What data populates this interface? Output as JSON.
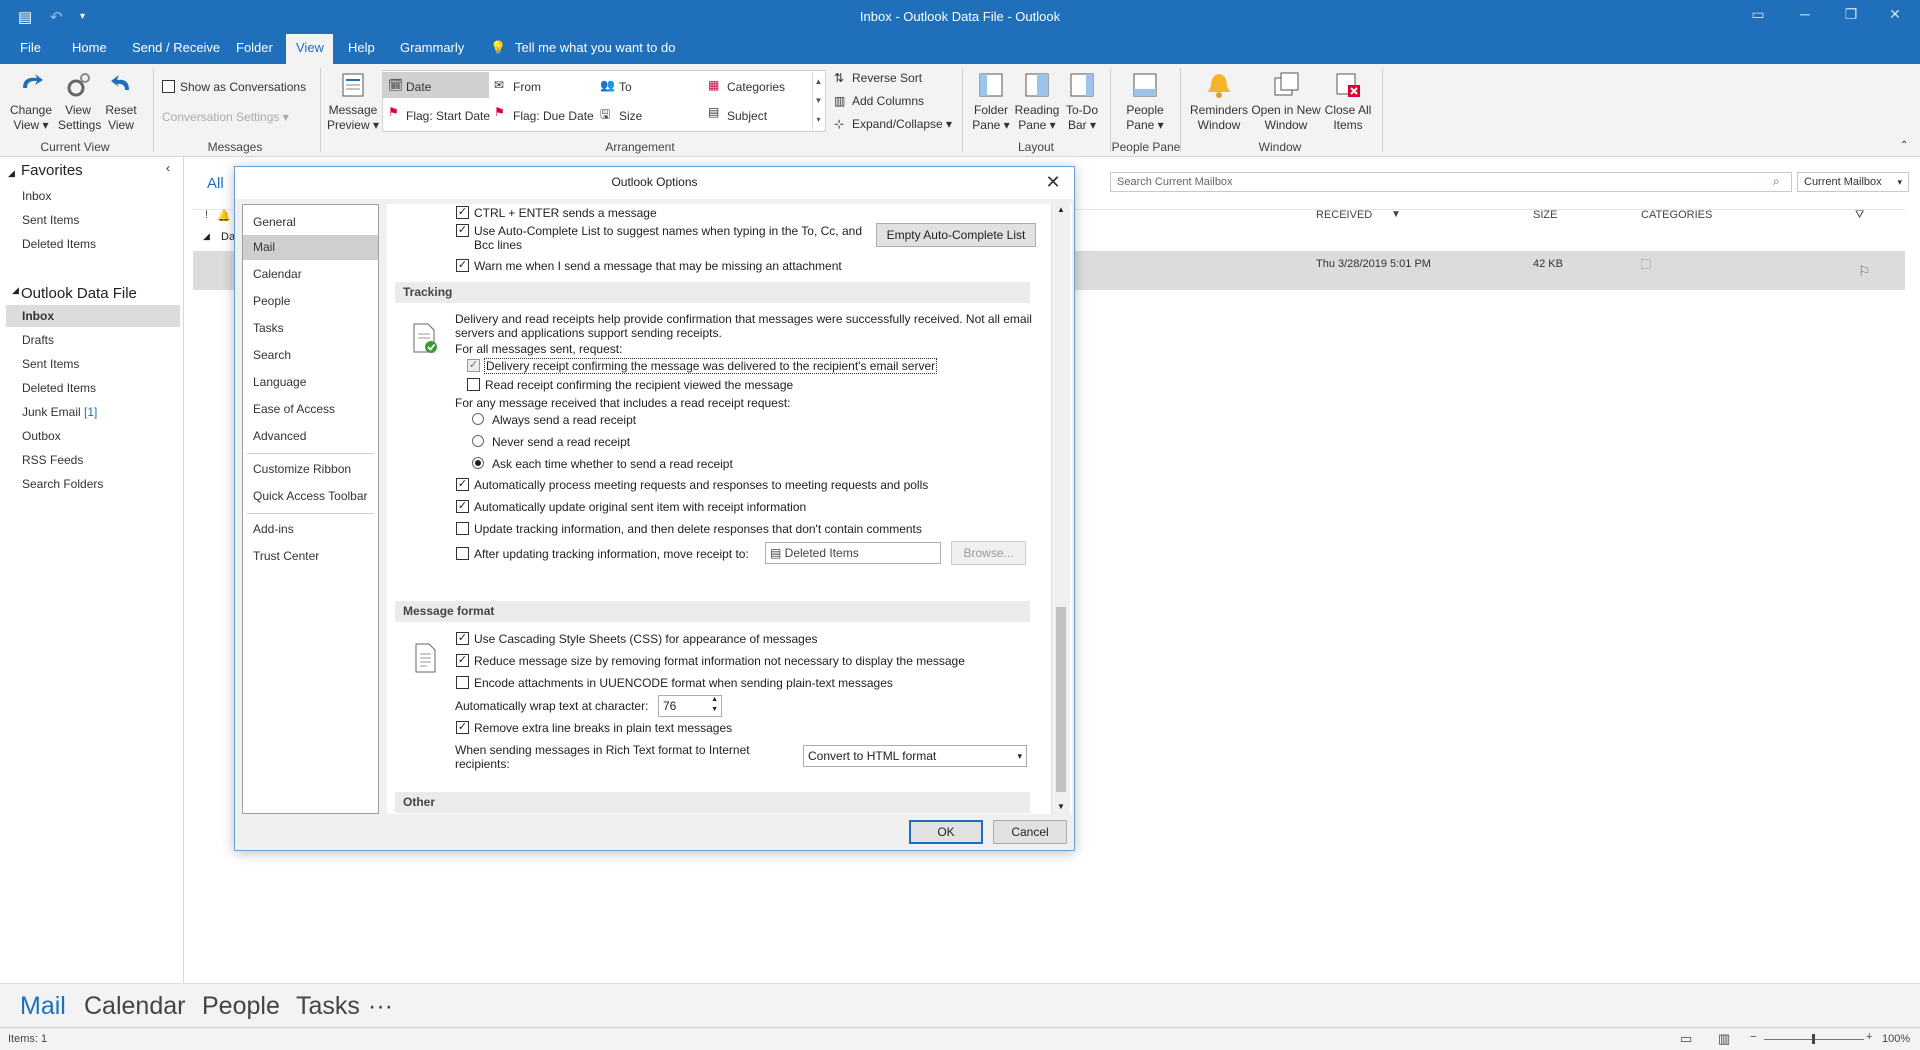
{
  "window": {
    "title": "Inbox - Outlook Data File  -  Outlook"
  },
  "menu": {
    "tabs": [
      "File",
      "Home",
      "Send / Receive",
      "Folder",
      "View",
      "Help",
      "Grammarly"
    ],
    "tell_me": "Tell me what you want to do"
  },
  "ribbon": {
    "current_view": {
      "change": "Change View ▾",
      "settings": "View Settings",
      "reset": "Reset View",
      "group": "Current View"
    },
    "messages": {
      "show_conv": "Show as Conversations",
      "conv_settings": "Conversation Settings ▾",
      "group": "Messages"
    },
    "preview": "Message Preview ▾",
    "arrangement": {
      "items": [
        "Date",
        "From",
        "To",
        "Categories",
        "Flag: Start Date",
        "Flag: Due Date",
        "Size",
        "Subject"
      ],
      "reverse": "Reverse Sort",
      "add_columns": "Add Columns",
      "expand": "Expand/Collapse ▾",
      "group": "Arrangement"
    },
    "layout": {
      "folder": "Folder Pane ▾",
      "reading": "Reading Pane ▾",
      "todo": "To-Do Bar ▾",
      "group": "Layout"
    },
    "people_pane": {
      "btn": "People Pane ▾",
      "group": "People Pane"
    },
    "window_grp": {
      "reminders": "Reminders Window",
      "open_new": "Open in New Window",
      "close_all": "Close All Items",
      "group": "Window"
    }
  },
  "nav": {
    "favorites": "Favorites",
    "fav_items": [
      "Inbox",
      "Sent Items",
      "Deleted Items"
    ],
    "datafile": "Outlook Data File",
    "items": [
      "Inbox",
      "Drafts",
      "Sent Items",
      "Deleted Items",
      "Junk Email",
      "Outbox",
      "RSS Feeds",
      "Search Folders"
    ],
    "junk_count": "[1]"
  },
  "list": {
    "filter_all": "All",
    "search_placeholder": "Search Current Mailbox",
    "scope": "Current Mailbox",
    "col_received": "RECEIVED",
    "col_size": "SIZE",
    "col_categories": "CATEGORIES",
    "group_label": "Da",
    "row_received": "Thu 3/28/2019 5:01 PM",
    "row_size": "42 KB"
  },
  "bottom": {
    "mail": "Mail",
    "calendar": "Calendar",
    "people": "People",
    "tasks": "Tasks",
    "more": "···"
  },
  "status": {
    "items": "Items: 1",
    "zoom": "100%"
  },
  "dialog": {
    "title": "Outlook Options",
    "categories": [
      "General",
      "Mail",
      "Calendar",
      "People",
      "Tasks",
      "Search",
      "Language",
      "Ease of Access",
      "Advanced",
      "Customize Ribbon",
      "Quick Access Toolbar",
      "Add-ins",
      "Trust Center"
    ],
    "top": {
      "ctrl_enter": "CTRL + ENTER sends a message",
      "autocomplete": "Use Auto-Complete List to suggest names when typing in the To, Cc, and",
      "autocomplete2": "Bcc lines",
      "empty_btn": "Empty Auto-Complete List",
      "warn": "Warn me when I send a message that may be missing an attachment"
    },
    "tracking": {
      "heading": "Tracking",
      "desc1": "Delivery and read receipts help provide confirmation that messages were successfully received. Not all email",
      "desc2": "servers and applications support sending receipts.",
      "for_all": "For all messages sent, request:",
      "delivery": "Delivery receipt confirming the message was delivered to the recipient's email server",
      "read": "Read receipt confirming the recipient viewed the message",
      "for_any": "For any message received that includes a read receipt request:",
      "always": "Always send a read receipt",
      "never": "Never send a read receipt",
      "ask": "Ask each time whether to send a read receipt",
      "auto_process": "Automatically process meeting requests and responses to meeting requests and polls",
      "auto_update": "Automatically update original sent item with receipt information",
      "update_delete": "Update tracking information, and then delete responses that don't contain comments",
      "after_update": "After updating tracking information, move receipt to:",
      "folder": "Deleted Items",
      "browse": "Browse..."
    },
    "format": {
      "heading": "Message format",
      "css": "Use Cascading Style Sheets (CSS) for appearance of messages",
      "reduce": "Reduce message size by removing format information not necessary to display the message",
      "encode": "Encode attachments in UUENCODE format when sending plain-text messages",
      "wrap": "Automatically wrap text at character:",
      "wrap_value": "76",
      "remove": "Remove extra line breaks in plain text messages",
      "rich1": "When sending messages in Rich Text format to Internet",
      "rich2": "recipients:",
      "rich_select": "Convert to HTML format"
    },
    "other": "Other",
    "ok": "OK",
    "cancel": "Cancel"
  },
  "colors": {
    "accent": "#1f6fba"
  }
}
